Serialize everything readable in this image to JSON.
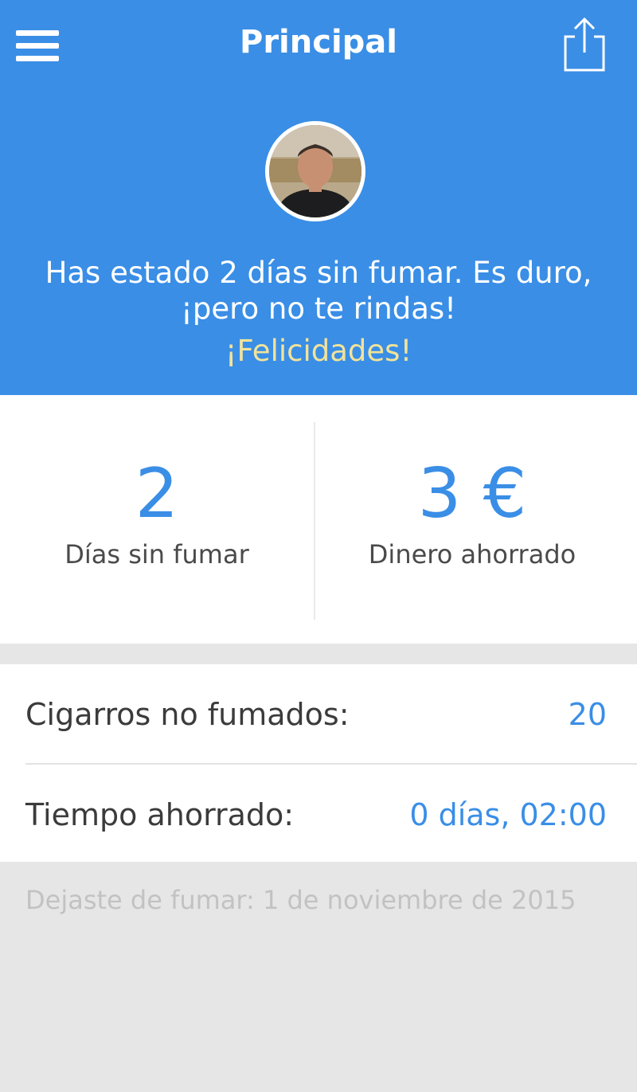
{
  "header": {
    "title": "Principal",
    "menu_icon": "hamburger-menu-icon",
    "share_icon": "share-icon"
  },
  "hero": {
    "message": "Has estado 2 días sin fumar. Es duro, ¡pero no te rindas!",
    "congrats": "¡Felicidades!"
  },
  "stats": {
    "days_value": "2",
    "days_label": "Días sin fumar",
    "money_value": "3 €",
    "money_label": "Dinero ahorrado"
  },
  "details": {
    "cigarettes_label": "Cigarros no fumados:",
    "cigarettes_value": "20",
    "time_label": "Tiempo ahorrado:",
    "time_value": "0 días, 02:00"
  },
  "footer": {
    "quit_date": "Dejaste de fumar: 1 de noviembre de 2015"
  },
  "colors": {
    "primary": "#3a8ee6",
    "congrats": "#f1e39a",
    "background": "#e6e6e6"
  }
}
